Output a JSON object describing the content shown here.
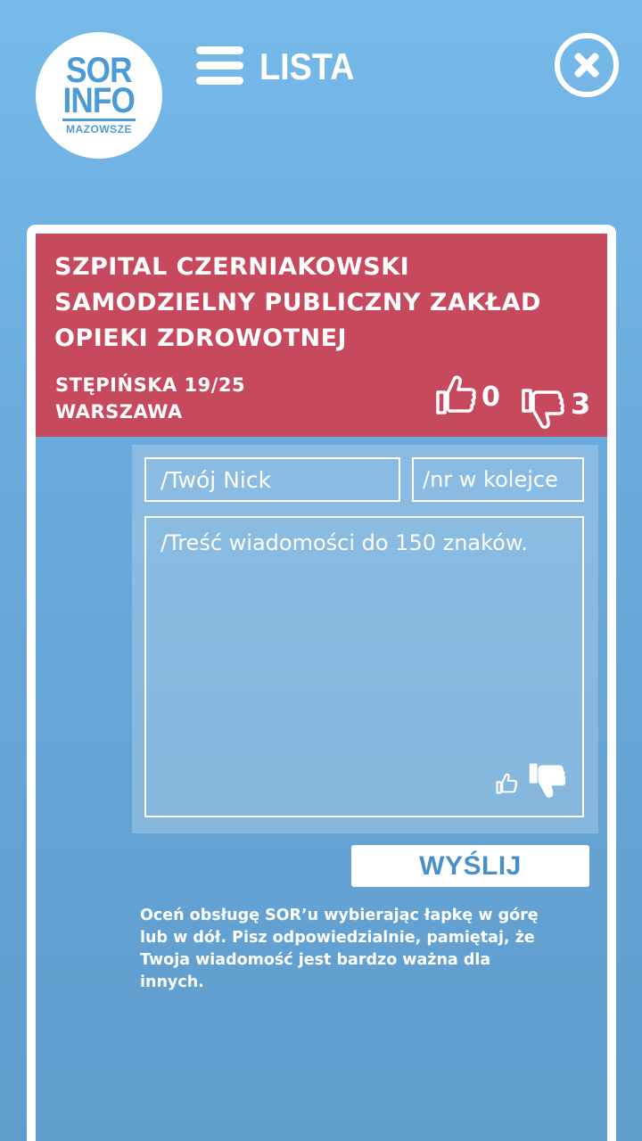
{
  "logo": {
    "line1": "SOR",
    "line2": "INFO",
    "line3": "MAZOWSZE"
  },
  "nav": {
    "menu_label": "LISTA"
  },
  "hospital": {
    "name": "SZPITAL CZERNIAKOWSKI SAMODZIELNY PUBLICZNY ZAKŁAD OPIEKI ZDROWOTNEJ",
    "street": "STĘPIŃSKA 19/25",
    "city": "WARSZAWA",
    "likes": "0",
    "dislikes": "3",
    "header_color": "#c7495d"
  },
  "form": {
    "nick_placeholder": "/Twój Nick",
    "queue_placeholder": "/nr w kolejce",
    "message_placeholder": "/Treść wiadomości do 150 znaków.",
    "submit_label": "WYŚLIJ"
  },
  "info_text": "Oceń obsługę SOR’u wybierając łapkę w górę lub w dół. Pisz odpowiedzialnie, pamiętaj, że Twoja wiadomość jest bardzo ważna dla innych.",
  "icons": [
    "thumbs-up-icon",
    "thumbs-down-icon",
    "close-icon",
    "hamburger-icon"
  ]
}
